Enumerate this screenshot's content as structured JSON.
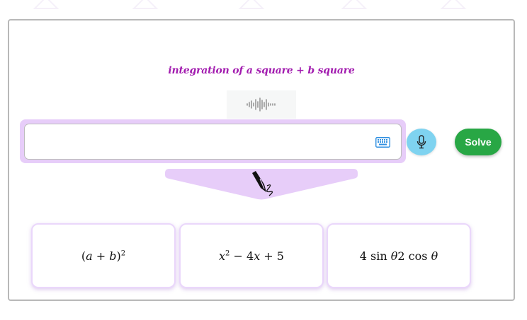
{
  "voice_transcript": "integration of a square + b square",
  "icons": {
    "waveform": "audio-waveform-icon",
    "keyboard": "keyboard-icon",
    "microphone": "microphone-icon",
    "handwriting": "pen-nib-icon"
  },
  "input": {
    "value": "",
    "placeholder": ""
  },
  "solve_label": "Solve",
  "examples": [
    {
      "parts": [
        "(",
        "a",
        " + ",
        "b",
        ")",
        "2"
      ]
    },
    {
      "parts": [
        "x",
        "2",
        " − 4",
        "x",
        " + 5"
      ]
    },
    {
      "parts": [
        "4 sin ",
        "θ",
        "2 cos ",
        "θ"
      ]
    }
  ],
  "colors": {
    "transcript": "#a21caf",
    "solve": "#28a745",
    "mic": "#7fd3f0",
    "input_highlight": "#e7cdf9",
    "handwriting_tab": "#e7cdf9"
  }
}
